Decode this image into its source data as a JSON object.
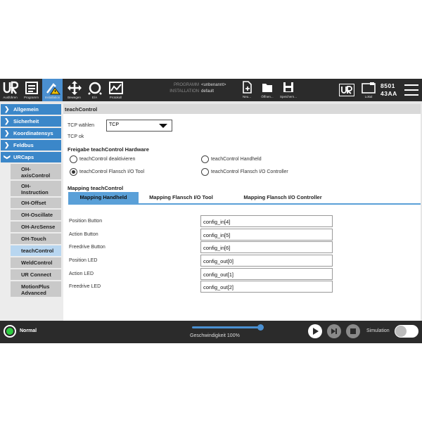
{
  "topbar": {
    "nav": [
      {
        "label": "Ausführen",
        "icon": "ur-logo-icon"
      },
      {
        "label": "Programm",
        "icon": "program-icon"
      },
      {
        "label": "Installation",
        "icon": "installation-icon"
      },
      {
        "label": "Bewegen",
        "icon": "move-icon"
      },
      {
        "label": "E/A",
        "icon": "io-icon"
      },
      {
        "label": "Protokoll",
        "icon": "log-icon"
      }
    ],
    "program_key": "PROGRAMM",
    "program_value": "<unbenannt>",
    "installation_key": "INSTALLATION",
    "installation_value": "default",
    "file_buttons": [
      {
        "label": "Neu...",
        "icon": "new-file-icon"
      },
      {
        "label": "Öffnen...",
        "icon": "folder-open-icon"
      },
      {
        "label": "Speichern...",
        "icon": "save-icon"
      }
    ],
    "local_label": "Lokal",
    "serial_line1": "8501",
    "serial_line2": "43AA"
  },
  "sidebar": {
    "items": [
      {
        "label": "Allgemein",
        "expanded": false
      },
      {
        "label": "Sicherheit",
        "expanded": false
      },
      {
        "label": "Koordinatensys",
        "expanded": false
      },
      {
        "label": "Feldbus",
        "expanded": false
      },
      {
        "label": "URCaps",
        "expanded": true
      }
    ],
    "urcaps": [
      {
        "label": "OH-\naxisControl",
        "selected": false
      },
      {
        "label": "OH-\nInstruction",
        "selected": false
      },
      {
        "label": "OH-Offset",
        "selected": false
      },
      {
        "label": "OH-Oscillate",
        "selected": false
      },
      {
        "label": "OH-ArcSense",
        "selected": false
      },
      {
        "label": "OH-Touch",
        "selected": false
      },
      {
        "label": "teachControl",
        "selected": true
      },
      {
        "label": "WeldControl",
        "selected": false
      },
      {
        "label": "UR Connect",
        "selected": false
      },
      {
        "label": "MotionPlus\nAdvanced",
        "selected": false
      }
    ]
  },
  "main": {
    "title": "teachControl",
    "tcp_label": "TCP wählen",
    "tcp_value": "TCP",
    "tcp_status": "TCP ok",
    "hardware_heading": "Freigabe teachControl Hardware",
    "radios": [
      {
        "label": "teachControl deaktivieren",
        "checked": false
      },
      {
        "label": "teachControl Handheld",
        "checked": false
      },
      {
        "label": "teachControl Flansch I/O Tool",
        "checked": true
      },
      {
        "label": "teachControl Flansch I/O Controller",
        "checked": false
      }
    ],
    "mapping_heading": "Mapping teachControl",
    "tabs": [
      {
        "label": "Mapping Handheld",
        "active": true
      },
      {
        "label": "Mapping Flansch I/O Tool",
        "active": false
      },
      {
        "label": "Mapping Flansch I/O Controller",
        "active": false
      }
    ],
    "mappings": [
      {
        "label": "Position Button",
        "value": "config_in[4]"
      },
      {
        "label": "Action Button",
        "value": "config_in[5]"
      },
      {
        "label": "Freedrive Button",
        "value": "config_in[6]"
      },
      {
        "label": "Position LED",
        "value": "config_out[0]"
      },
      {
        "label": "Action LED",
        "value": "config_out[1]"
      },
      {
        "label": "Freedrive LED",
        "value": "config_out[2]"
      }
    ]
  },
  "footer": {
    "status": "Normal",
    "status_color": "#2ecc40",
    "speed_label": "Geschwindigkeit 100%",
    "speed_percent": 100,
    "simulation_label": "Simulation",
    "simulation_on": false
  }
}
